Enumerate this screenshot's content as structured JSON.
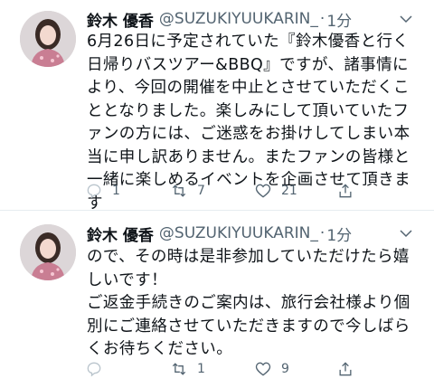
{
  "tweets": [
    {
      "author_name": "鈴木 優香",
      "handle": "@SUZUKIYUUKARIN_",
      "separator": "·",
      "time": "1分",
      "text": "6月26日に予定されていた『鈴木優香と行く日帰りバスツアー&BBQ』ですが、諸事情により、今回の開催を中止とさせていただくこととなりました。楽しみにして頂いていたファンの方には、ご迷惑をお掛けしてしまい本当に申し訳ありません。またファンの皆様と一緒に楽しめるイベントを企画させて頂きます",
      "replies": "1",
      "retweets": "7",
      "likes": "21"
    },
    {
      "author_name": "鈴木 優香",
      "handle": "@SUZUKIYUUKARIN_",
      "separator": "·",
      "time": "1分",
      "text": "ので、その時は是非参加していただけたら嬉しいです！\nご返金手続きのご案内は、旅行会社様より個別にご連絡させていただきますので今しばらくお待ちください。",
      "replies": "",
      "retweets": "1",
      "likes": "9"
    }
  ],
  "colors": {
    "text": "#0f1419",
    "secondary": "#536471",
    "divider": "#e6ecf0"
  },
  "icons": [
    "reply-icon",
    "retweet-icon",
    "like-icon",
    "share-icon",
    "chevron-down-icon"
  ]
}
